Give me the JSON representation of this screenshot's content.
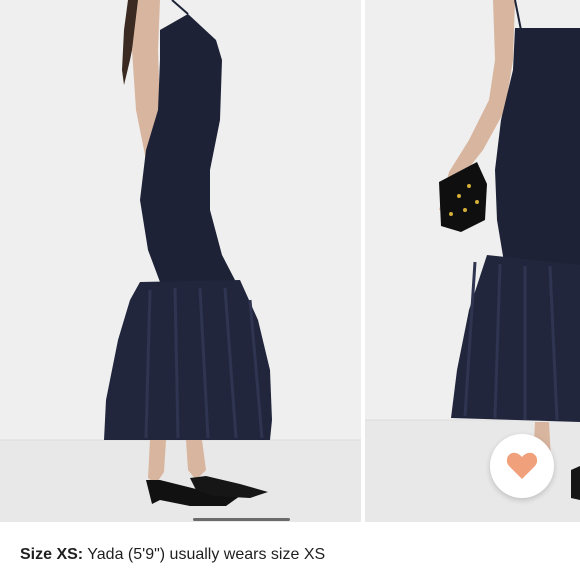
{
  "size_info": {
    "label": "Size XS:",
    "text": " Yada (5'9\") usually wears size XS"
  },
  "like_button": {
    "icon": "heart-icon",
    "color": "#F0A07A"
  },
  "colors": {
    "dress": "#1e2236",
    "background": "#efefef"
  }
}
